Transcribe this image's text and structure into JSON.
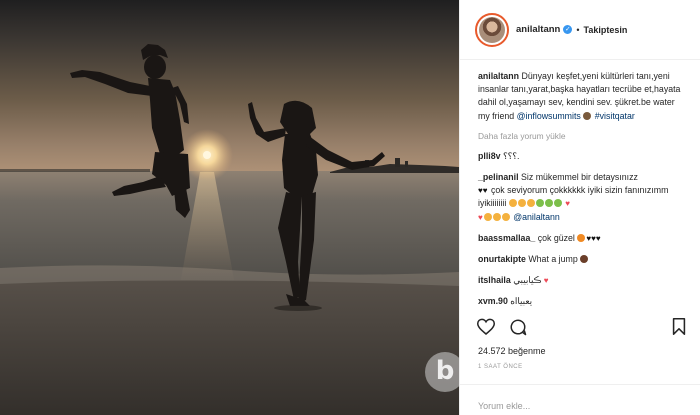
{
  "post": {
    "username": "anilaltann",
    "follow_label": "Takiptesin",
    "caption_user": "anilaltann",
    "caption_text": "Dünyayı keşfet,yeni kültürleri tanı,yeni insanlar tanı,yarat,başka hayatları tecrübe et,hayata dahil ol,yaşamayı sev, kendini sev. şükret.be water my friend",
    "caption_tag": "@inflowsummits",
    "caption_hashtag": "#visitqatar",
    "load_more": "Daha fazla yorum yükle",
    "likes": "24.572 beğenme",
    "time": "1 SAAT ÖNCE",
    "comment_placeholder": "Yorum ekle..."
  },
  "comments": [
    {
      "user": "plli8v",
      "text": "؟؟؟."
    },
    {
      "user": "_pelinanil",
      "text": "Siz mükemmel bir detaysınızz",
      "line2": "çok seviyorum çokkkkkk iyiki sizin fanınızımm iyikiiiiiiii",
      "mention": "@anilaltann"
    },
    {
      "user": "baassmallaa_",
      "text": "çok güzel"
    },
    {
      "user": "onurtakipte",
      "text": "What a jump"
    },
    {
      "user": "itslhaila",
      "text": "ڪيابيبي"
    },
    {
      "user": "xvm.90",
      "text": "يعبيااه"
    }
  ],
  "icons": {
    "verified": "verified-badge-icon",
    "heart": "heart-icon",
    "comment": "comment-bubble-icon",
    "save": "bookmark-icon",
    "watermark": "b"
  },
  "colors": {
    "link": "#003569",
    "verified": "#3897f0",
    "heart": "#ed4956",
    "muted": "#999999"
  }
}
